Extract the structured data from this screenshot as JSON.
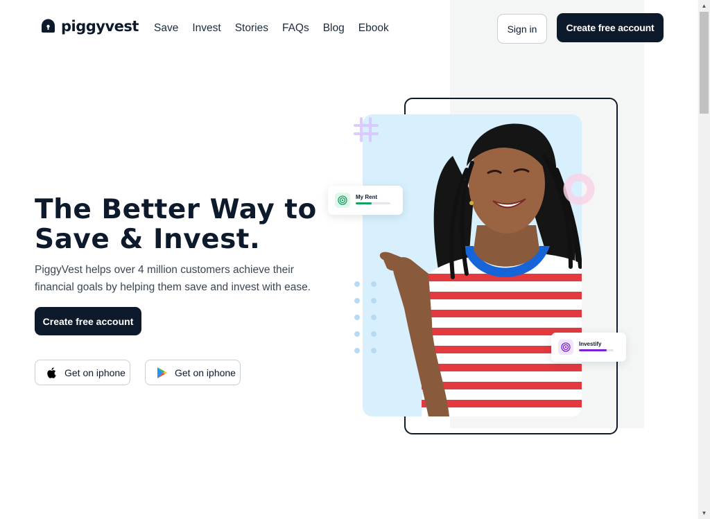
{
  "header": {
    "brand": "piggyvest",
    "nav": [
      "Save",
      "Invest",
      "Stories",
      "FAQs",
      "Blog",
      "Ebook"
    ],
    "signin_label": "Sign in",
    "create_label": "Create free account"
  },
  "hero": {
    "title_line1": "The Better Way to",
    "title_line2": "Save & Invest.",
    "subtitle": "PiggyVest helps over 4 million customers achieve their financial goals by helping them save and invest with ease.",
    "cta_label": "Create free account",
    "store_buttons": [
      {
        "label": "Get on iphone",
        "icon": "apple-icon"
      },
      {
        "label": "Get on iphone",
        "icon": "google-play-icon"
      }
    ]
  },
  "illustration": {
    "cards": [
      {
        "label": "My Rent",
        "progress": 0.45,
        "color": "#0ea360",
        "icon": "target-icon"
      },
      {
        "label": "Investify",
        "progress": 0.8,
        "color": "#7b22d6",
        "icon": "target-icon"
      }
    ]
  },
  "colors": {
    "brand_dark": "#0d1a2b",
    "photo_bg": "#d8f0fd",
    "panel_bg": "#f4f6f6"
  }
}
